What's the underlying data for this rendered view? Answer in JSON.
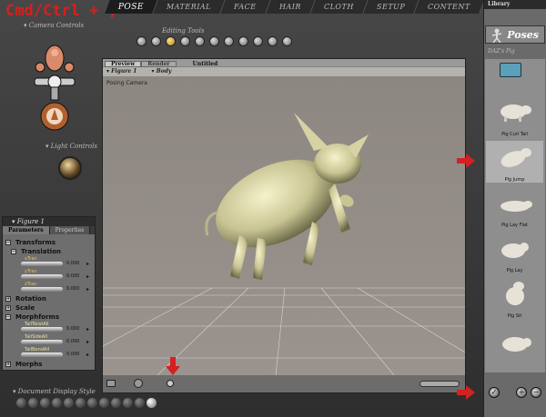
{
  "overlay_text": "Cmd/Ctrl + ,",
  "tabs": [
    "POSE",
    "MATERIAL",
    "FACE",
    "HAIR",
    "CLOTH",
    "SETUP",
    "CONTENT"
  ],
  "active_tab": "POSE",
  "camera_controls_label": "Camera Controls",
  "editing_tools_label": "Editing Tools",
  "editing_tools": [
    "rotate",
    "twist",
    "translate",
    "scale",
    "taper",
    "chain-break",
    "color",
    "grouping",
    "view-magnifier",
    "morph-brush",
    "direct-manip"
  ],
  "light_controls_label": "Light Controls",
  "left_panel": {
    "title": "Figure 1",
    "tabs": [
      "Parameters",
      "Properties"
    ],
    "groups": [
      {
        "label": "Transforms",
        "level": 0
      },
      {
        "label": "Translation",
        "level": 1
      },
      {
        "label": "Rotation",
        "level": 0
      },
      {
        "label": "Scale",
        "level": 0
      },
      {
        "label": "Morphforms",
        "level": 0
      },
      {
        "label": "Morphs",
        "level": 0
      }
    ],
    "dials": [
      {
        "name": "xTran",
        "value": "0.000"
      },
      {
        "name": "yTran",
        "value": "0.000"
      },
      {
        "name": "zTran",
        "value": "0.000"
      },
      {
        "name": "TailTwistAll",
        "value": "0.000"
      },
      {
        "name": "TailSideAll",
        "value": "0.000"
      },
      {
        "name": "TailBendAll",
        "value": "0.000"
      }
    ]
  },
  "document_display_style_label": "Document Display Style",
  "preview": {
    "tabs": [
      "Preview",
      "Render"
    ],
    "document_title": "Untitled",
    "figure_selector": "Figure 1",
    "actor_selector": "Body",
    "camera_label": "Posing Camera"
  },
  "library": {
    "title": "Library",
    "category": "Poses",
    "subfolder": "DAZ's Pig",
    "items": [
      {
        "label": "Pig Curl Tail",
        "selected": false
      },
      {
        "label": "Pig Jump",
        "selected": true
      },
      {
        "label": "Pig Lay Flat",
        "selected": false
      },
      {
        "label": "Pig Lay",
        "selected": false
      },
      {
        "label": "Pig Sit",
        "selected": false
      },
      {
        "label": "",
        "selected": false
      }
    ]
  },
  "colors": {
    "accent_red": "#d42020",
    "pig": "#e9e5b8"
  }
}
